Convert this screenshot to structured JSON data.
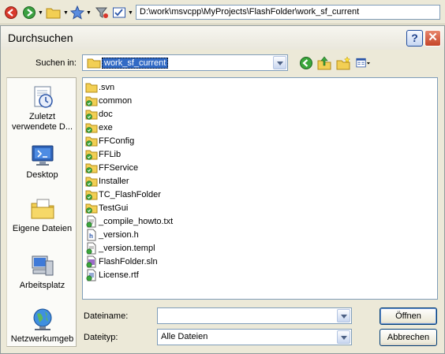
{
  "toolbar": {
    "address": "D:\\work\\msvcpp\\MyProjects\\FlashFolder\\work_sf_current",
    "buttons": [
      "back-icon",
      "forward-icon",
      "folder-icon",
      "favorites-icon",
      "filter-icon",
      "options-icon"
    ]
  },
  "dialog": {
    "title": "Durchsuchen",
    "help_label": "?",
    "close_label": "✕",
    "lookin_label": "Suchen in:",
    "lookin_value": "work_sf_current",
    "places": [
      {
        "label": "Zuletzt verwendete D...",
        "icon": "recent-documents-icon"
      },
      {
        "label": "Desktop",
        "icon": "desktop-icon"
      },
      {
        "label": "Eigene Dateien",
        "icon": "my-documents-icon"
      },
      {
        "label": "Arbeitsplatz",
        "icon": "my-computer-icon"
      },
      {
        "label": "Netzwerkumgeb",
        "icon": "network-icon"
      }
    ],
    "files": [
      {
        "name": ".svn",
        "kind": "folder"
      },
      {
        "name": "common",
        "kind": "folder-svn"
      },
      {
        "name": "doc",
        "kind": "folder-svn"
      },
      {
        "name": "exe",
        "kind": "folder-svn"
      },
      {
        "name": "FFConfig",
        "kind": "folder-svn"
      },
      {
        "name": "FFLib",
        "kind": "folder-svn"
      },
      {
        "name": "FFService",
        "kind": "folder-svn"
      },
      {
        "name": "Installer",
        "kind": "folder-svn"
      },
      {
        "name": "TC_FlashFolder",
        "kind": "folder-svn"
      },
      {
        "name": "TestGui",
        "kind": "folder-svn"
      },
      {
        "name": "_compile_howto.txt",
        "kind": "txt"
      },
      {
        "name": "_version.h",
        "kind": "h"
      },
      {
        "name": "_version.templ",
        "kind": "templ"
      },
      {
        "name": "FlashFolder.sln",
        "kind": "sln"
      },
      {
        "name": "License.rtf",
        "kind": "rtf"
      }
    ],
    "filename_label": "Dateiname:",
    "filename_value": "",
    "filetype_label": "Dateityp:",
    "filetype_value": "Alle Dateien",
    "open_label": "Öffnen",
    "cancel_label": "Abbrechen"
  }
}
